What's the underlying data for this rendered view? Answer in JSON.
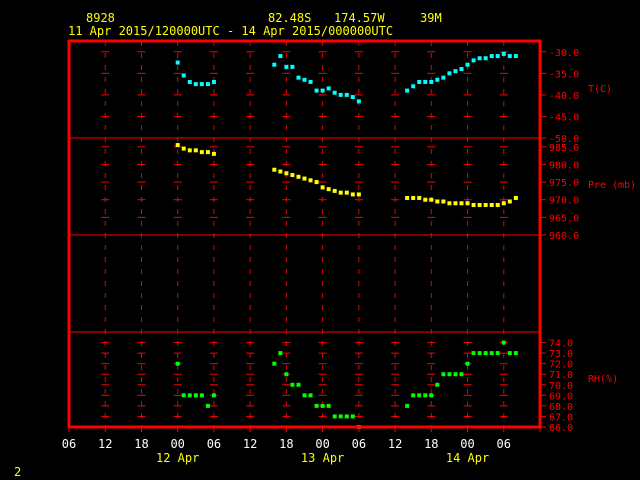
{
  "header": {
    "station": "8928",
    "lat": "82.48S",
    "lon": "174.57W",
    "elev": "39M",
    "range": "11 Apr 2015/120000UTC - 14 Apr 2015/000000UTC"
  },
  "footer": {
    "page_number": "2"
  },
  "colors": {
    "background": "#000000",
    "frame": "#ff0000",
    "header_text": "#ffff00",
    "temperature": "#00ffff",
    "pressure": "#ffff00",
    "humidity": "#00ff00"
  },
  "chart_data": [
    {
      "type": "scatter",
      "panel": "temperature",
      "ylabel": "T(C)",
      "ylim": [
        -50,
        -27.5
      ],
      "yticks": [
        -30,
        -35,
        -40,
        -45,
        -50
      ],
      "ytick_labels": [
        "-30.0",
        "-35.0",
        "-40.0",
        "-45.0",
        "-50.0"
      ],
      "x": [
        12,
        13,
        14,
        15,
        16,
        17,
        18,
        28,
        29,
        30,
        31,
        32,
        33,
        34,
        35,
        36,
        37,
        38,
        39,
        40,
        41,
        42,
        50,
        51,
        52,
        53,
        54,
        55,
        56,
        57,
        58,
        59,
        60,
        61,
        62,
        63,
        64,
        65,
        66,
        67,
        68
      ],
      "values": [
        -32.5,
        -35.5,
        -37,
        -37.5,
        -37.5,
        -37.5,
        -37,
        -33,
        -31,
        -33.5,
        -33.5,
        -36,
        -36.5,
        -37,
        -39,
        -39,
        -38.5,
        -39.5,
        -40,
        -40,
        -40.5,
        -41.5,
        -39,
        -38,
        -37,
        -37,
        -37,
        -36.5,
        -36,
        -35,
        -34.5,
        -34,
        -33,
        -32,
        -31.5,
        -31.5,
        -31,
        -31,
        -30.5,
        -31,
        -31
      ]
    },
    {
      "type": "scatter",
      "panel": "pressure",
      "ylabel": "Pre (mb)",
      "ylim": [
        960,
        987.5
      ],
      "yticks": [
        960,
        965,
        970,
        975,
        980,
        985
      ],
      "ytick_labels": [
        "960.0",
        "965.0",
        "970.0",
        "975.0",
        "980.0",
        "985.0"
      ],
      "x": [
        12,
        13,
        14,
        15,
        16,
        17,
        18,
        28,
        29,
        30,
        31,
        32,
        33,
        34,
        35,
        36,
        37,
        38,
        39,
        40,
        41,
        42,
        50,
        51,
        52,
        53,
        54,
        55,
        56,
        57,
        58,
        59,
        60,
        61,
        62,
        63,
        64,
        65,
        66,
        67,
        68
      ],
      "values": [
        985.5,
        984.5,
        984,
        984,
        983.5,
        983.5,
        983,
        978.5,
        978,
        977.5,
        977,
        976.5,
        976,
        975.5,
        975,
        973.5,
        973,
        972.5,
        972,
        972,
        971.5,
        971.5,
        970.5,
        970.5,
        970.5,
        970,
        970,
        969.5,
        969.5,
        969,
        969,
        969,
        969,
        968.5,
        968.5,
        968.5,
        968.5,
        968.5,
        969,
        969.5,
        970.5
      ]
    },
    {
      "type": "scatter",
      "panel": "humidity",
      "ylabel": "RH(%)",
      "ylim": [
        66,
        75
      ],
      "yticks": [
        66,
        67,
        68,
        69,
        70,
        71,
        72,
        73,
        74
      ],
      "ytick_labels": [
        "66.0",
        "67.0",
        "68.0",
        "69.0",
        "70.0",
        "71.0",
        "72.0",
        "73.0",
        "74.0"
      ],
      "x": [
        12,
        13,
        14,
        15,
        16,
        17,
        18,
        28,
        29,
        30,
        31,
        32,
        33,
        34,
        35,
        36,
        37,
        38,
        39,
        40,
        41,
        42,
        50,
        51,
        52,
        53,
        54,
        55,
        56,
        57,
        58,
        59,
        60,
        61,
        62,
        63,
        64,
        65,
        66,
        67,
        68
      ],
      "values": [
        72,
        69,
        69,
        69,
        69,
        68,
        69,
        72,
        73,
        71,
        70,
        70,
        69,
        69,
        68,
        68,
        68,
        67,
        67,
        67,
        67,
        66,
        68,
        69,
        69,
        69,
        69,
        70,
        71,
        71,
        71,
        71,
        72,
        73,
        73,
        73,
        73,
        73,
        74,
        73,
        73
      ]
    }
  ],
  "xaxis": {
    "lim": [
      -6,
      72
    ],
    "ticks": [
      -6,
      0,
      6,
      12,
      18,
      24,
      30,
      36,
      42,
      48,
      54,
      60,
      66,
      72
    ],
    "tick_labels": [
      "06",
      "12",
      "18",
      "00",
      "06",
      "12",
      "18",
      "00",
      "06",
      "12",
      "18",
      "00",
      "06"
    ],
    "day_labels": [
      "12 Apr",
      "13 Apr",
      "14 Apr"
    ]
  }
}
